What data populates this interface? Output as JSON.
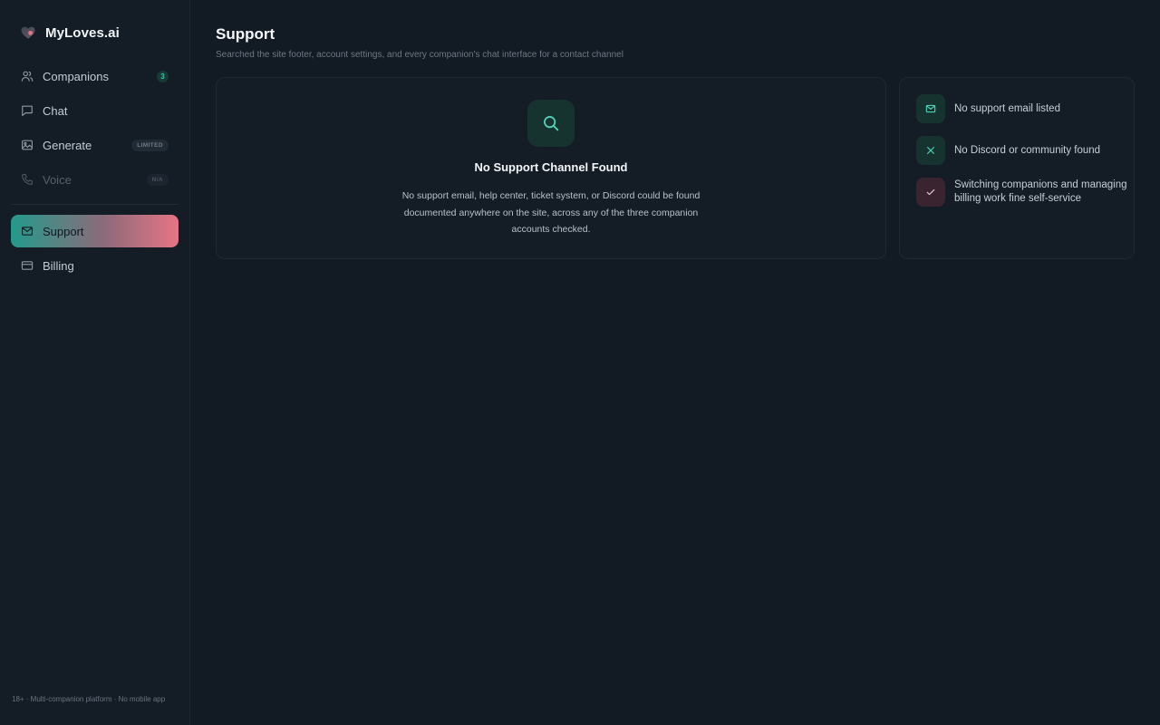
{
  "app": {
    "name": "MyLoves.ai"
  },
  "colors": {
    "accent_teal": "#239a8c",
    "accent_pink": "#e57585",
    "background": "#121a23"
  },
  "sidebar": {
    "items": [
      {
        "label": "Companions",
        "icon": "users-icon",
        "badge": "3"
      },
      {
        "label": "Chat",
        "icon": "chat-icon"
      },
      {
        "label": "Generate",
        "icon": "image-icon",
        "badge": "LIMITED"
      },
      {
        "label": "Voice",
        "icon": "phone-icon",
        "badge": "N/A",
        "disabled": true
      },
      {
        "label": "Support",
        "icon": "mail-icon",
        "active": true
      },
      {
        "label": "Billing",
        "icon": "card-icon"
      }
    ],
    "footer": "18+ · Multi-companion platform · No mobile app"
  },
  "main": {
    "title": "Support",
    "subtitle": "Searched the site footer, account settings, and every companion's chat interface for a contact channel",
    "empty_state": {
      "icon": "search-icon",
      "title": "No Support Channel Found",
      "description": "No support email, help center, ticket system, or Discord could be found documented anywhere on the site, across any of the three companion accounts checked."
    },
    "checks": [
      {
        "icon": "mail-icon",
        "text": "No support email listed"
      },
      {
        "icon": "close-icon",
        "text": "No Discord or community found"
      },
      {
        "icon": "check-icon",
        "text": "Switching companions and managing billing work fine self-service"
      }
    ]
  }
}
